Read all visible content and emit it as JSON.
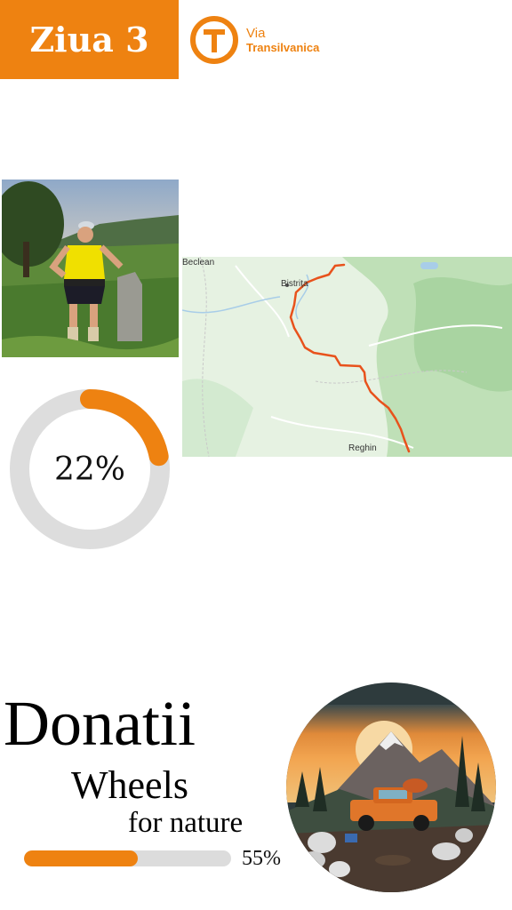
{
  "header": {
    "day_label": "Ziua 3",
    "logo": {
      "icon": "via-transilvanica-t-icon",
      "line1": "Via",
      "line2": "Transilvanica"
    }
  },
  "map": {
    "places": {
      "beclean": "Beclean",
      "bistrita": "Bistrița",
      "reghin": "Reghin"
    },
    "route_color": "#e8521c"
  },
  "progress": {
    "value": 0.22,
    "label": "22%",
    "color": "#ee8211",
    "track_color": "#dddddd"
  },
  "donations": {
    "title": "Donatii",
    "subtitle_line1": "Wheels",
    "subtitle_line2": "for nature",
    "value": 0.55,
    "label": "55%"
  },
  "colors": {
    "accent": "#ee8211"
  }
}
